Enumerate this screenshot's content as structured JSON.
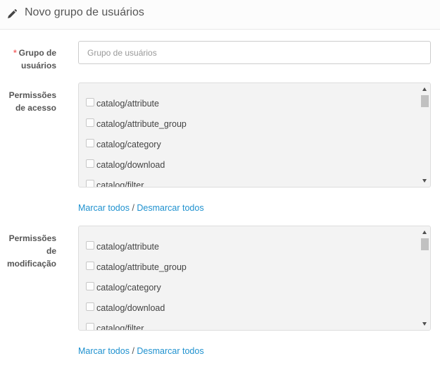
{
  "header": {
    "title": "Novo grupo de usuários",
    "icon": "pencil-icon"
  },
  "form": {
    "group_name": {
      "required_mark": "*",
      "label_line1": "Grupo de",
      "label_line2": "usuários",
      "value": "",
      "placeholder": "Grupo de usuários"
    },
    "access": {
      "label_line1": "Permissões",
      "label_line2": "de acesso",
      "items": [
        {
          "label": "catalog/attribute",
          "checked": false
        },
        {
          "label": "catalog/attribute_group",
          "checked": false
        },
        {
          "label": "catalog/category",
          "checked": false
        },
        {
          "label": "catalog/download",
          "checked": false
        },
        {
          "label": "catalog/filter",
          "checked": false
        }
      ],
      "select_all": "Marcar todos",
      "separator": "/",
      "deselect_all": "Desmarcar todos"
    },
    "modify": {
      "label_line1": "Permissões",
      "label_line2": "de",
      "label_line3": "modificação",
      "items": [
        {
          "label": "catalog/attribute",
          "checked": false
        },
        {
          "label": "catalog/attribute_group",
          "checked": false
        },
        {
          "label": "catalog/category",
          "checked": false
        },
        {
          "label": "catalog/download",
          "checked": false
        },
        {
          "label": "catalog/filter",
          "checked": false
        }
      ],
      "select_all": "Marcar todos",
      "separator": "/",
      "deselect_all": "Desmarcar todos"
    }
  },
  "colors": {
    "link": "#1e91cf",
    "required": "#f56b6b",
    "well_bg": "#f3f3f3"
  }
}
